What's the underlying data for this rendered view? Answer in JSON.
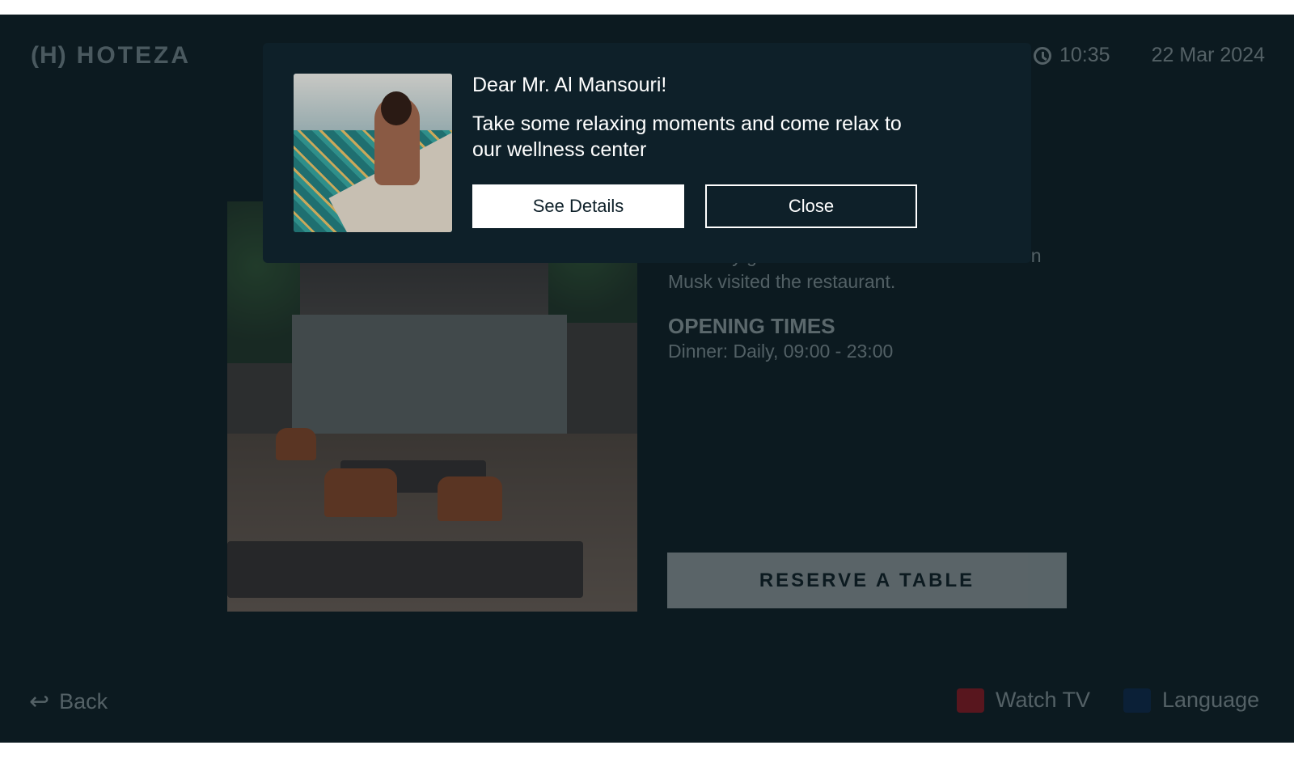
{
  "header": {
    "logo_mark": "(H)",
    "logo_text": "HOTEZA",
    "time": "10:35",
    "date": "22 Mar 2024"
  },
  "content": {
    "description": "Celebrity guests include Steve Jobs and Elon Musk visited the restaurant.",
    "opening_heading": "OPENING TIMES",
    "opening_times": "Dinner: Daily, 09:00 - 23:00",
    "reserve_label": "RESERVE A TABLE"
  },
  "footer": {
    "back_label": "Back",
    "watch_tv_label": "Watch TV",
    "language_label": "Language",
    "watch_tv_color": "#c1121c",
    "language_color": "#0b2a57"
  },
  "modal": {
    "title": "Dear Mr. Al Mansouri!",
    "message": "Take some relaxing moments and come relax to our wellness center",
    "details_label": "See Details",
    "close_label": "Close"
  },
  "colors": {
    "screen_bg": "#0c1a20",
    "modal_bg": "#0e2029"
  }
}
